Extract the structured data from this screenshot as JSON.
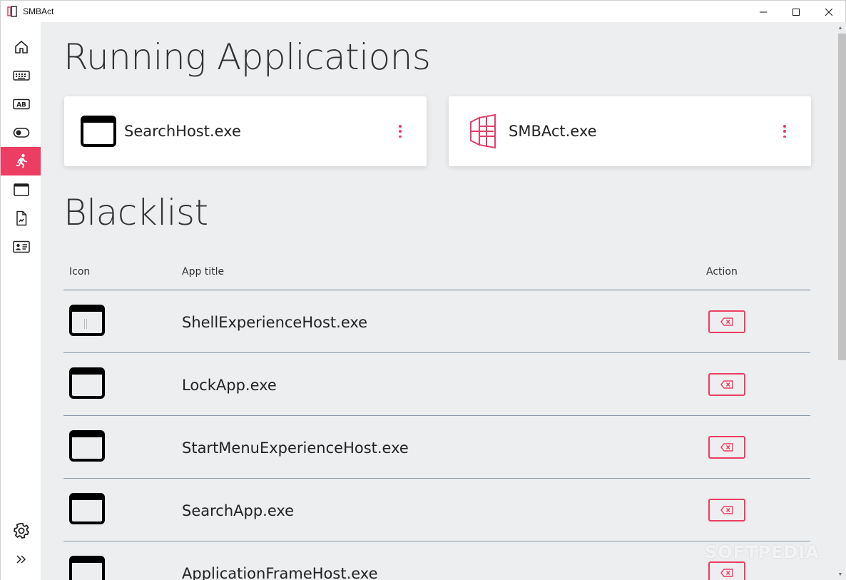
{
  "window": {
    "title": "SMBAct",
    "icon": "smbact-logo-icon",
    "controls": [
      "minimize-icon",
      "maximize-icon",
      "close-icon"
    ]
  },
  "sidebar": {
    "items": [
      {
        "icon": "home-icon",
        "active": false
      },
      {
        "icon": "keyboard-icon",
        "active": false
      },
      {
        "icon": "text-ab-icon",
        "active": false
      },
      {
        "icon": "toggle-icon",
        "active": false
      },
      {
        "icon": "running-person-icon",
        "active": true
      },
      {
        "icon": "window-icon",
        "active": false
      },
      {
        "icon": "document-icon",
        "active": false
      },
      {
        "icon": "id-card-icon",
        "active": false
      }
    ],
    "bottom": [
      {
        "icon": "gear-icon"
      },
      {
        "icon": "double-chevron-right-icon"
      }
    ]
  },
  "running": {
    "heading": "Running Applications",
    "apps": [
      {
        "name": "SearchHost.exe",
        "icon": "window-icon"
      },
      {
        "name": "SMBAct.exe",
        "icon": "smbact-logo-icon"
      }
    ]
  },
  "blacklist": {
    "heading": "Blacklist",
    "columns": {
      "icon": "Icon",
      "title": "App title",
      "action": "Action"
    },
    "rows": [
      {
        "title": "ShellExperienceHost.exe"
      },
      {
        "title": "LockApp.exe"
      },
      {
        "title": "StartMenuExperienceHost.exe"
      },
      {
        "title": "SearchApp.exe"
      },
      {
        "title": "ApplicationFrameHost.exe"
      }
    ]
  },
  "colors": {
    "accent": "#ec3e63",
    "background": "#eceef0"
  },
  "watermark": "SOFTPEDIA"
}
